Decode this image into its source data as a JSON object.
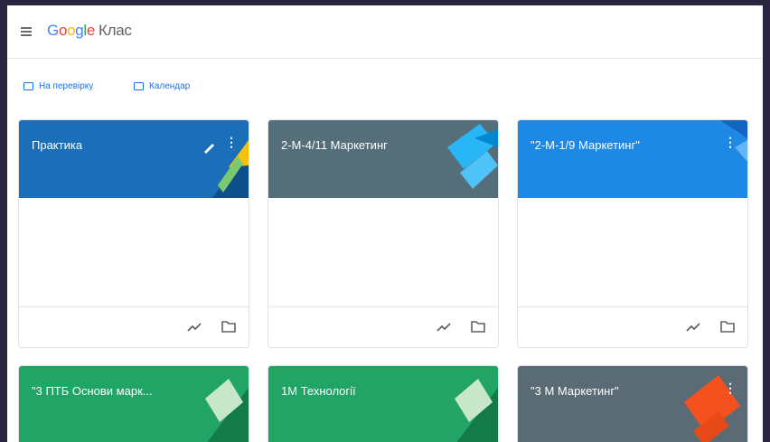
{
  "app": {
    "google": "Google",
    "product": "Клас"
  },
  "links": [
    {
      "label": "На перевірку",
      "icon": "checklist-icon"
    },
    {
      "label": "Календар",
      "icon": "calendar-icon"
    }
  ],
  "colors": {
    "blue": "#1a6fb8",
    "gray": "#546e7a",
    "brightBlue": "#1e88e5",
    "green": "#21a465",
    "slate": "#5b6b75",
    "accent": "#1a73e8"
  },
  "cards": [
    {
      "title": "Практика",
      "color": "blue"
    },
    {
      "title": "2-М-4/11 Маркетинг",
      "color": "gray"
    },
    {
      "title": "\"2-М-1/9 Маркетинг\"",
      "color": "brightBlue"
    },
    {
      "title": "\"3 ПТБ Основи марк...",
      "color": "green"
    },
    {
      "title": "1М Технології",
      "color": "green"
    },
    {
      "title": "\"3 М Маркетинг\"",
      "color": "slate"
    }
  ]
}
